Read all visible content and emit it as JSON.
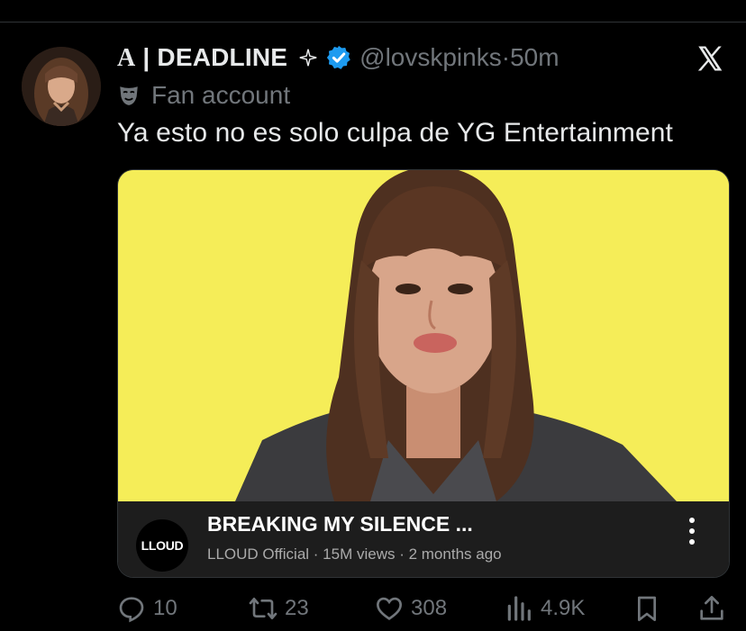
{
  "tweet": {
    "author_prefix": "A",
    "author_name": "DEADLINE",
    "handle": "@lovskpinks",
    "separator": "·",
    "time": "50m",
    "fan_label": "Fan account",
    "text": "Ya esto no es solo culpa de YG Entertainment"
  },
  "video": {
    "title": "BREAKING MY SILENCE ...",
    "channel_logo_text": "LLOUD",
    "channel": "LLOUD Official",
    "views": "15M views",
    "age": "2 months ago"
  },
  "actions": {
    "replies": "10",
    "reposts": "23",
    "likes": "308",
    "views": "4.9K"
  },
  "colors": {
    "background": "#000000",
    "text": "#e7e9ea",
    "muted": "#71767b",
    "verified": "#1d9bf0",
    "thumbnail_bg": "#f5ed58",
    "video_bar": "#1d1d1d"
  }
}
